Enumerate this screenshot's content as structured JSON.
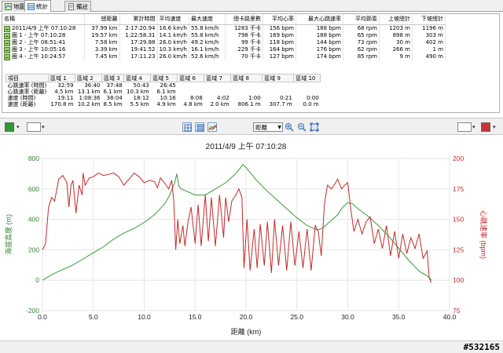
{
  "tabs": [
    {
      "label": "地圖"
    },
    {
      "label": "統計"
    },
    {
      "label": "備註"
    }
  ],
  "laps_table": {
    "headers": [
      "名稱",
      "總距離",
      "累計時間",
      "平均速度",
      "最大速度",
      "總卡路里數",
      "平均心率",
      "最大心跳速率",
      "平均節奏",
      "上坡總計",
      "下坡總計"
    ],
    "rows": [
      {
        "name": "2011/4/9 上午 07:10:28",
        "dist": "37.99 km",
        "time": "2:17:20.94",
        "avg_speed": "16.6 km/h",
        "max_speed": "55.8 km/h",
        "cal": "1283 千卡",
        "avg_hr": "156 bpm",
        "max_hr": "188 bpm",
        "cad": "68 rpm",
        "up": "1203 m",
        "down": "1196 m"
      },
      {
        "name": "圈 1 - 上午 07:10:28",
        "dist": "19.57 km",
        "time": "1:22:58.31",
        "avg_speed": "14.1 km/h",
        "max_speed": "55.8 km/h",
        "cal": "798 千卡",
        "avg_hr": "169 bpm",
        "max_hr": "188 bpm",
        "cad": "65 rpm",
        "up": "898 m",
        "down": "303 m"
      },
      {
        "name": "圈 2 - 上午 08:51:41",
        "dist": "7.58 km",
        "time": "17:29.88",
        "avg_speed": "26.0 km/h",
        "max_speed": "49.2 km/h",
        "cal": "99 千卡",
        "avg_hr": "118 bpm",
        "max_hr": "144 bpm",
        "cad": "73 rpm",
        "up": "30 m",
        "down": "402 m"
      },
      {
        "name": "圈 3 - 上午 10:05:16",
        "dist": "3.39 km",
        "time": "19:41.52",
        "avg_speed": "10.3 km/h",
        "max_speed": "16.1 km/h",
        "cal": "229 千卡",
        "avg_hr": "164 bpm",
        "max_hr": "176 bpm",
        "cad": "62 rpm",
        "up": "266 m",
        "down": "1 m"
      },
      {
        "name": "圈 4 - 上午 10:24:57",
        "dist": "7.45 km",
        "time": "17:11.23",
        "avg_speed": "26.0 km/h",
        "max_speed": "52.6 km/h",
        "cal": "70 千卡",
        "avg_hr": "127 bpm",
        "max_hr": "174 bpm",
        "cad": "85 rpm",
        "up": "9 m",
        "down": "490 m"
      }
    ]
  },
  "zones_table": {
    "headers": [
      "項目",
      "區域 1",
      "區域 2",
      "區域 3",
      "區域 4",
      "區域 5",
      "區域 6",
      "區域 7",
      "區域 8",
      "區域 9",
      "區域 10"
    ],
    "rows": [
      {
        "label": "心跳速率 (時間)",
        "cells": [
          "32:59",
          "36:40",
          "37:48",
          "50:43",
          "26:45",
          "",
          "",
          "",
          "",
          ""
        ]
      },
      {
        "label": "心跳速率 (距離)",
        "cells": [
          "4.5 km",
          "13.1 km",
          "6.1 km",
          "10.3 km",
          "6.1 km",
          "",
          "",
          "",
          "",
          ""
        ]
      },
      {
        "label": "速度 (時間)",
        "cells": [
          "19:11",
          "1:08:36",
          "38:04",
          "18:12",
          "10:16",
          "8:08",
          "4:02",
          "1:00",
          "0:21",
          "0:00"
        ]
      },
      {
        "label": "速度 (距離)",
        "cells": [
          "170.8 m",
          "10.2 km",
          "8.5 km",
          "5.5 km",
          "4.9 km",
          "4.8 km",
          "2.0 km",
          "806.1 m",
          "307.7 m",
          "0.0 m"
        ]
      }
    ]
  },
  "toolbar": {
    "left_color": "#2e9a2e",
    "right_color": "#cc3333",
    "x_axis_select": "距離"
  },
  "chart_data": {
    "type": "line",
    "title": "2011/4/9 上午 07:10:28",
    "xlabel": "距離 (km)",
    "ylabel_left": "海拔高度 (m)",
    "ylabel_right": "心跳速率 (bpm)",
    "xlim": [
      0,
      40
    ],
    "ylim_left": [
      -200,
      800
    ],
    "ylim_right": [
      75,
      200
    ],
    "x_ticks": [
      "0.0",
      "5.0",
      "10.0",
      "15.0",
      "20.0",
      "25.0",
      "30.0",
      "35.0",
      "40.0"
    ],
    "y_ticks_left": [
      "800",
      "600",
      "400",
      "200",
      "0",
      "-200"
    ],
    "y_ticks_right": [
      "200",
      "175",
      "150",
      "125",
      "100",
      "75"
    ],
    "grid": true,
    "series": [
      {
        "name": "海拔高度 (m)",
        "color": "#3a9a3a",
        "axis": "left",
        "points": [
          [
            0,
            0
          ],
          [
            0.5,
            20
          ],
          [
            1,
            40
          ],
          [
            2,
            70
          ],
          [
            3,
            100
          ],
          [
            4,
            140
          ],
          [
            5,
            180
          ],
          [
            6,
            220
          ],
          [
            7,
            270
          ],
          [
            8,
            310
          ],
          [
            9,
            340
          ],
          [
            10,
            380
          ],
          [
            11,
            430
          ],
          [
            12,
            500
          ],
          [
            12.5,
            560
          ],
          [
            13,
            640
          ],
          [
            13.2,
            700
          ],
          [
            13.4,
            620
          ],
          [
            13.6,
            600
          ],
          [
            14,
            590
          ],
          [
            15,
            560
          ],
          [
            16,
            560
          ],
          [
            17,
            600
          ],
          [
            18,
            640
          ],
          [
            19,
            700
          ],
          [
            19.7,
            760
          ],
          [
            20,
            740
          ],
          [
            21,
            660
          ],
          [
            22,
            590
          ],
          [
            23,
            530
          ],
          [
            24,
            470
          ],
          [
            25,
            410
          ],
          [
            26,
            360
          ],
          [
            27,
            330
          ],
          [
            27.5,
            340
          ],
          [
            28,
            370
          ],
          [
            29,
            430
          ],
          [
            29.5,
            480
          ],
          [
            30,
            510
          ],
          [
            30.5,
            500
          ],
          [
            31,
            470
          ],
          [
            32,
            420
          ],
          [
            33,
            360
          ],
          [
            34,
            290
          ],
          [
            35,
            210
          ],
          [
            36,
            130
          ],
          [
            37,
            60
          ],
          [
            38,
            20
          ],
          [
            38.2,
            0
          ]
        ]
      },
      {
        "name": "心跳速率 (bpm)",
        "color": "#c42a2a",
        "axis": "right",
        "points": [
          [
            0,
            125
          ],
          [
            0.3,
            130
          ],
          [
            0.6,
            160
          ],
          [
            0.9,
            168
          ],
          [
            1.2,
            165
          ],
          [
            1.6,
            183
          ],
          [
            2,
            186
          ],
          [
            2.4,
            180
          ],
          [
            2.6,
            160
          ],
          [
            2.8,
            178
          ],
          [
            3,
            182
          ],
          [
            3.3,
            155
          ],
          [
            3.6,
            178
          ],
          [
            3.9,
            170
          ],
          [
            4,
            188
          ],
          [
            4.2,
            178
          ],
          [
            4.6,
            184
          ],
          [
            5,
            185
          ],
          [
            5.5,
            188
          ],
          [
            6,
            186
          ],
          [
            6.5,
            187
          ],
          [
            7,
            188
          ],
          [
            7.5,
            185
          ],
          [
            8,
            178
          ],
          [
            8.5,
            183
          ],
          [
            9,
            188
          ],
          [
            9.5,
            185
          ],
          [
            10,
            180
          ],
          [
            10.5,
            182
          ],
          [
            11,
            181
          ],
          [
            11.3,
            176
          ],
          [
            11.6,
            184
          ],
          [
            12,
            180
          ],
          [
            12.4,
            175
          ],
          [
            12.7,
            182
          ],
          [
            12.9,
            165
          ],
          [
            13.1,
            125
          ],
          [
            13.3,
            150
          ],
          [
            13.5,
            130
          ],
          [
            13.8,
            145
          ],
          [
            14,
            128
          ],
          [
            14.3,
            148
          ],
          [
            14.6,
            160
          ],
          [
            15,
            130
          ],
          [
            15.3,
            162
          ],
          [
            15.6,
            128
          ],
          [
            16,
            170
          ],
          [
            16.3,
            132
          ],
          [
            16.6,
            168
          ],
          [
            17,
            128
          ],
          [
            17.4,
            170
          ],
          [
            17.8,
            135
          ],
          [
            18,
            168
          ],
          [
            18.3,
            148
          ],
          [
            18.6,
            165
          ],
          [
            19,
            170
          ],
          [
            19.3,
            175
          ],
          [
            19.6,
            168
          ],
          [
            19.8,
            110
          ],
          [
            20.1,
            150
          ],
          [
            20.4,
            108
          ],
          [
            20.8,
            142
          ],
          [
            21.1,
            110
          ],
          [
            21.4,
            146
          ],
          [
            21.8,
            112
          ],
          [
            22.1,
            148
          ],
          [
            22.5,
            106
          ],
          [
            22.8,
            150
          ],
          [
            23.2,
            112
          ],
          [
            23.6,
            145
          ],
          [
            24,
            108
          ],
          [
            24.4,
            148
          ],
          [
            24.8,
            112
          ],
          [
            25.2,
            140
          ],
          [
            25.6,
            110
          ],
          [
            26,
            142
          ],
          [
            26.4,
            108
          ],
          [
            26.8,
            145
          ],
          [
            27.1,
            140
          ],
          [
            27.4,
            120
          ],
          [
            27.7,
            162
          ],
          [
            28,
            178
          ],
          [
            28.4,
            175
          ],
          [
            28.8,
            180
          ],
          [
            29,
            183
          ],
          [
            29.4,
            175
          ],
          [
            29.7,
            178
          ],
          [
            30,
            180
          ],
          [
            30.3,
            158
          ],
          [
            30.6,
            140
          ],
          [
            31,
            150
          ],
          [
            31.4,
            138
          ],
          [
            31.8,
            148
          ],
          [
            32.2,
            152
          ],
          [
            32.6,
            130
          ],
          [
            33,
            142
          ],
          [
            33.4,
            126
          ],
          [
            33.8,
            145
          ],
          [
            34.2,
            120
          ],
          [
            34.6,
            140
          ],
          [
            35,
            118
          ],
          [
            35.4,
            138
          ],
          [
            35.8,
            122
          ],
          [
            36.2,
            135
          ],
          [
            36.6,
            126
          ],
          [
            37,
            138
          ],
          [
            37.4,
            118
          ],
          [
            37.8,
            124
          ],
          [
            38,
            102
          ],
          [
            38.2,
            98
          ]
        ]
      }
    ]
  },
  "watermark": "#532165"
}
